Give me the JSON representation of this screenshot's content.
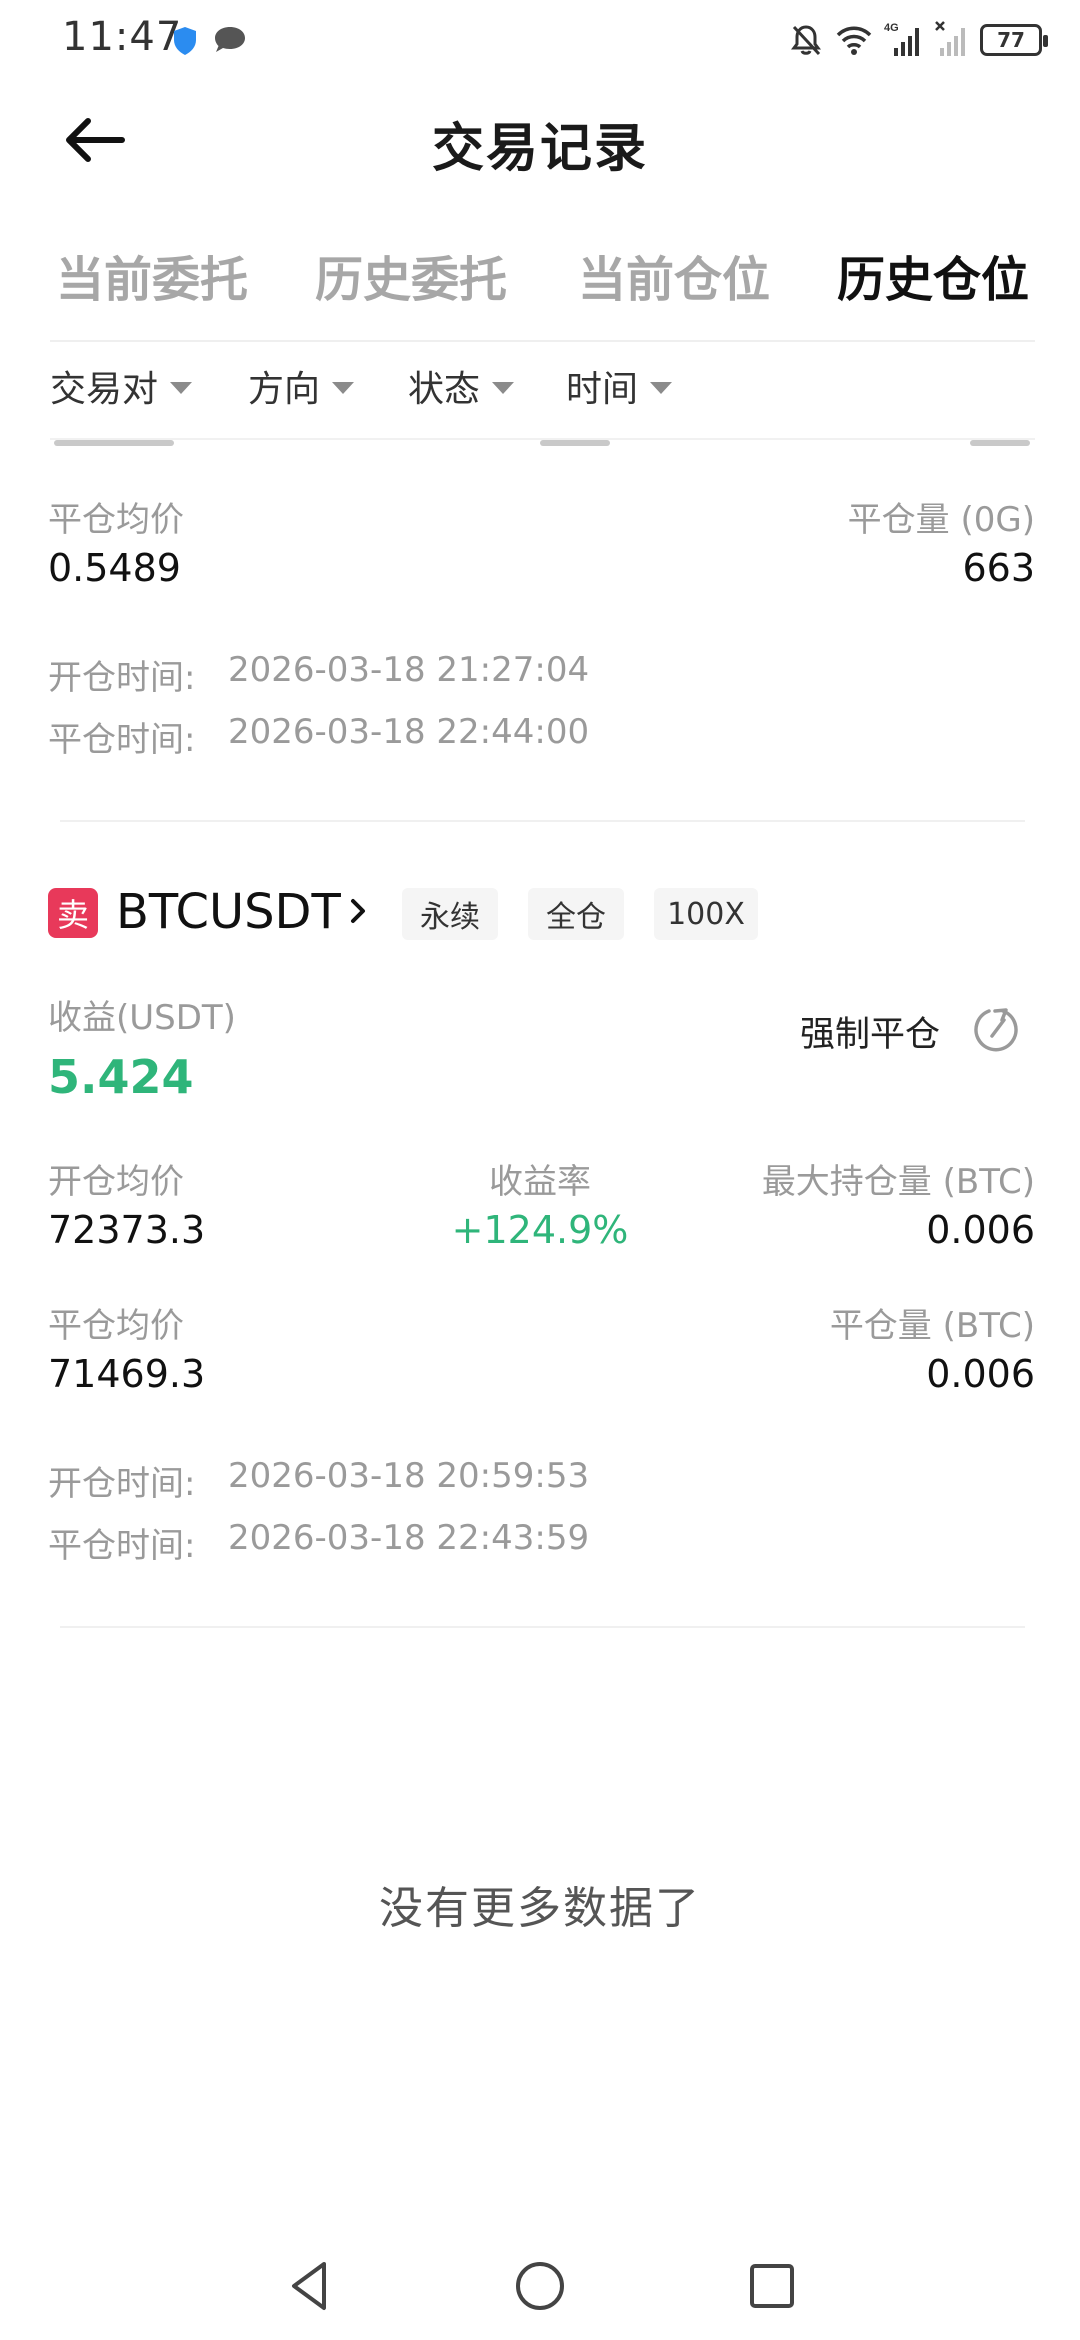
{
  "status_bar": {
    "time": "11:47",
    "battery": "77",
    "network": "4G"
  },
  "header": {
    "title": "交易记录"
  },
  "tabs": [
    {
      "label": "当前委托",
      "active": false
    },
    {
      "label": "历史委托",
      "active": false
    },
    {
      "label": "当前仓位",
      "active": false
    },
    {
      "label": "历史仓位",
      "active": true
    }
  ],
  "filters": [
    {
      "label": "交易对"
    },
    {
      "label": "方向"
    },
    {
      "label": "状态"
    },
    {
      "label": "时间"
    }
  ],
  "record1": {
    "close_avg_label": "平仓均价",
    "close_avg": "0.5489",
    "close_qty_label": "平仓量 (0G)",
    "close_qty": "663",
    "open_time_label": "开仓时间:",
    "open_time": "2026-03-18 21:27:04",
    "close_time_label": "平仓时间:",
    "close_time": "2026-03-18 22:44:00"
  },
  "record2": {
    "side": "卖",
    "symbol": "BTCUSDT",
    "tags": [
      "永续",
      "全仓",
      "100X"
    ],
    "pnl_label": "收益(USDT)",
    "pnl": "5.424",
    "force_close": "强制平仓",
    "open_avg_label": "开仓均价",
    "open_avg": "72373.3",
    "rate_label": "收益率",
    "rate": "+124.9%",
    "max_pos_label": "最大持仓量 (BTC)",
    "max_pos": "0.006",
    "close_avg_label": "平仓均价",
    "close_avg": "71469.3",
    "close_qty_label": "平仓量 (BTC)",
    "close_qty": "0.006",
    "open_time_label": "开仓时间:",
    "open_time": "2026-03-18 20:59:53",
    "close_time_label": "平仓时间:",
    "close_time": "2026-03-18 22:43:59"
  },
  "footer": {
    "no_more": "没有更多数据了"
  },
  "colors": {
    "profit": "#2fb57a",
    "sell": "#e8395a",
    "muted": "#9a9a9a"
  },
  "icons": {
    "back": "arrow-left-icon",
    "chevron": "chevron-right-icon",
    "force": "force-close-icon",
    "nav": [
      "back-triangle-icon",
      "home-circle-icon",
      "recents-square-icon"
    ]
  }
}
